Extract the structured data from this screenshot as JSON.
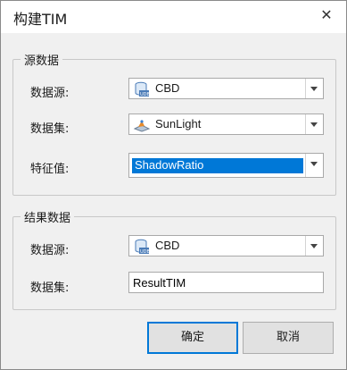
{
  "window": {
    "title": "构建TIM"
  },
  "source_group": {
    "legend": "源数据",
    "datasource_label": "数据源:",
    "datasource_value": "CBD",
    "dataset_label": "数据集:",
    "dataset_value": "SunLight",
    "field_label": "特征值:",
    "field_value": "ShadowRatio"
  },
  "result_group": {
    "legend": "结果数据",
    "datasource_label": "数据源:",
    "datasource_value": "CBD",
    "dataset_label": "数据集:",
    "dataset_value": "ResultTIM"
  },
  "buttons": {
    "ok": "确定",
    "cancel": "取消"
  },
  "icons": {
    "close": "close-icon",
    "datasource": "database-icon",
    "dataset": "raster-dataset-icon",
    "dropdown": "chevron-down-icon"
  },
  "colors": {
    "selection": "#0078d7",
    "default_button_border": "#0078d7"
  }
}
